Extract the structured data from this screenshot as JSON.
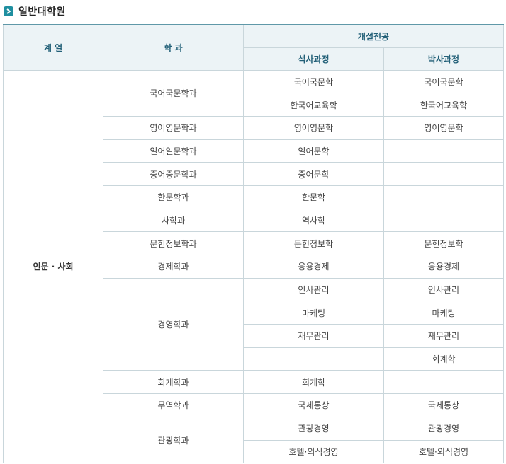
{
  "title": "일반대학원",
  "title_icon": "chevron-right-icon",
  "header": {
    "category": "계 열",
    "department": "학 과",
    "majors": "개설전공",
    "masters": "석사과정",
    "doctoral": "박사과정"
  },
  "category": "인문 · 사회",
  "rows": [
    {
      "dept": "국어국문학과",
      "master": "국어국문학",
      "doctor": "국어국문학"
    },
    {
      "dept": "",
      "master": "한국어교육학",
      "doctor": "한국어교육학"
    },
    {
      "dept": "영어영문학과",
      "master": "영어영문학",
      "doctor": "영어영문학"
    },
    {
      "dept": "일어일문학과",
      "master": "일어문학",
      "doctor": ""
    },
    {
      "dept": "중어중문학과",
      "master": "중어문학",
      "doctor": ""
    },
    {
      "dept": "한문학과",
      "master": "한문학",
      "doctor": ""
    },
    {
      "dept": "사학과",
      "master": "역사학",
      "doctor": ""
    },
    {
      "dept": "문헌정보학과",
      "master": "문헌정보학",
      "doctor": "문헌정보학"
    },
    {
      "dept": "경제학과",
      "master": "응용경제",
      "doctor": "응용경제"
    },
    {
      "dept": "경영학과",
      "master": "인사관리",
      "doctor": "인사관리"
    },
    {
      "dept": "",
      "master": "마케팅",
      "doctor": "마케팅"
    },
    {
      "dept": "",
      "master": "재무관리",
      "doctor": "재무관리"
    },
    {
      "dept": "",
      "master": "",
      "doctor": "회계학"
    },
    {
      "dept": "회계학과",
      "master": "회계학",
      "doctor": ""
    },
    {
      "dept": "무역학과",
      "master": "국제통상",
      "doctor": "국제통상"
    },
    {
      "dept": "관광학과",
      "master": "관광경영",
      "doctor": "관광경영"
    },
    {
      "dept": "",
      "master": "호텔·외식경영",
      "doctor": "호텔·외식경영"
    }
  ],
  "colors": {
    "accent": "#1f8fa0",
    "header_bg": "#ecf3f6",
    "header_text": "#215f77",
    "border": "#c9d6db"
  }
}
